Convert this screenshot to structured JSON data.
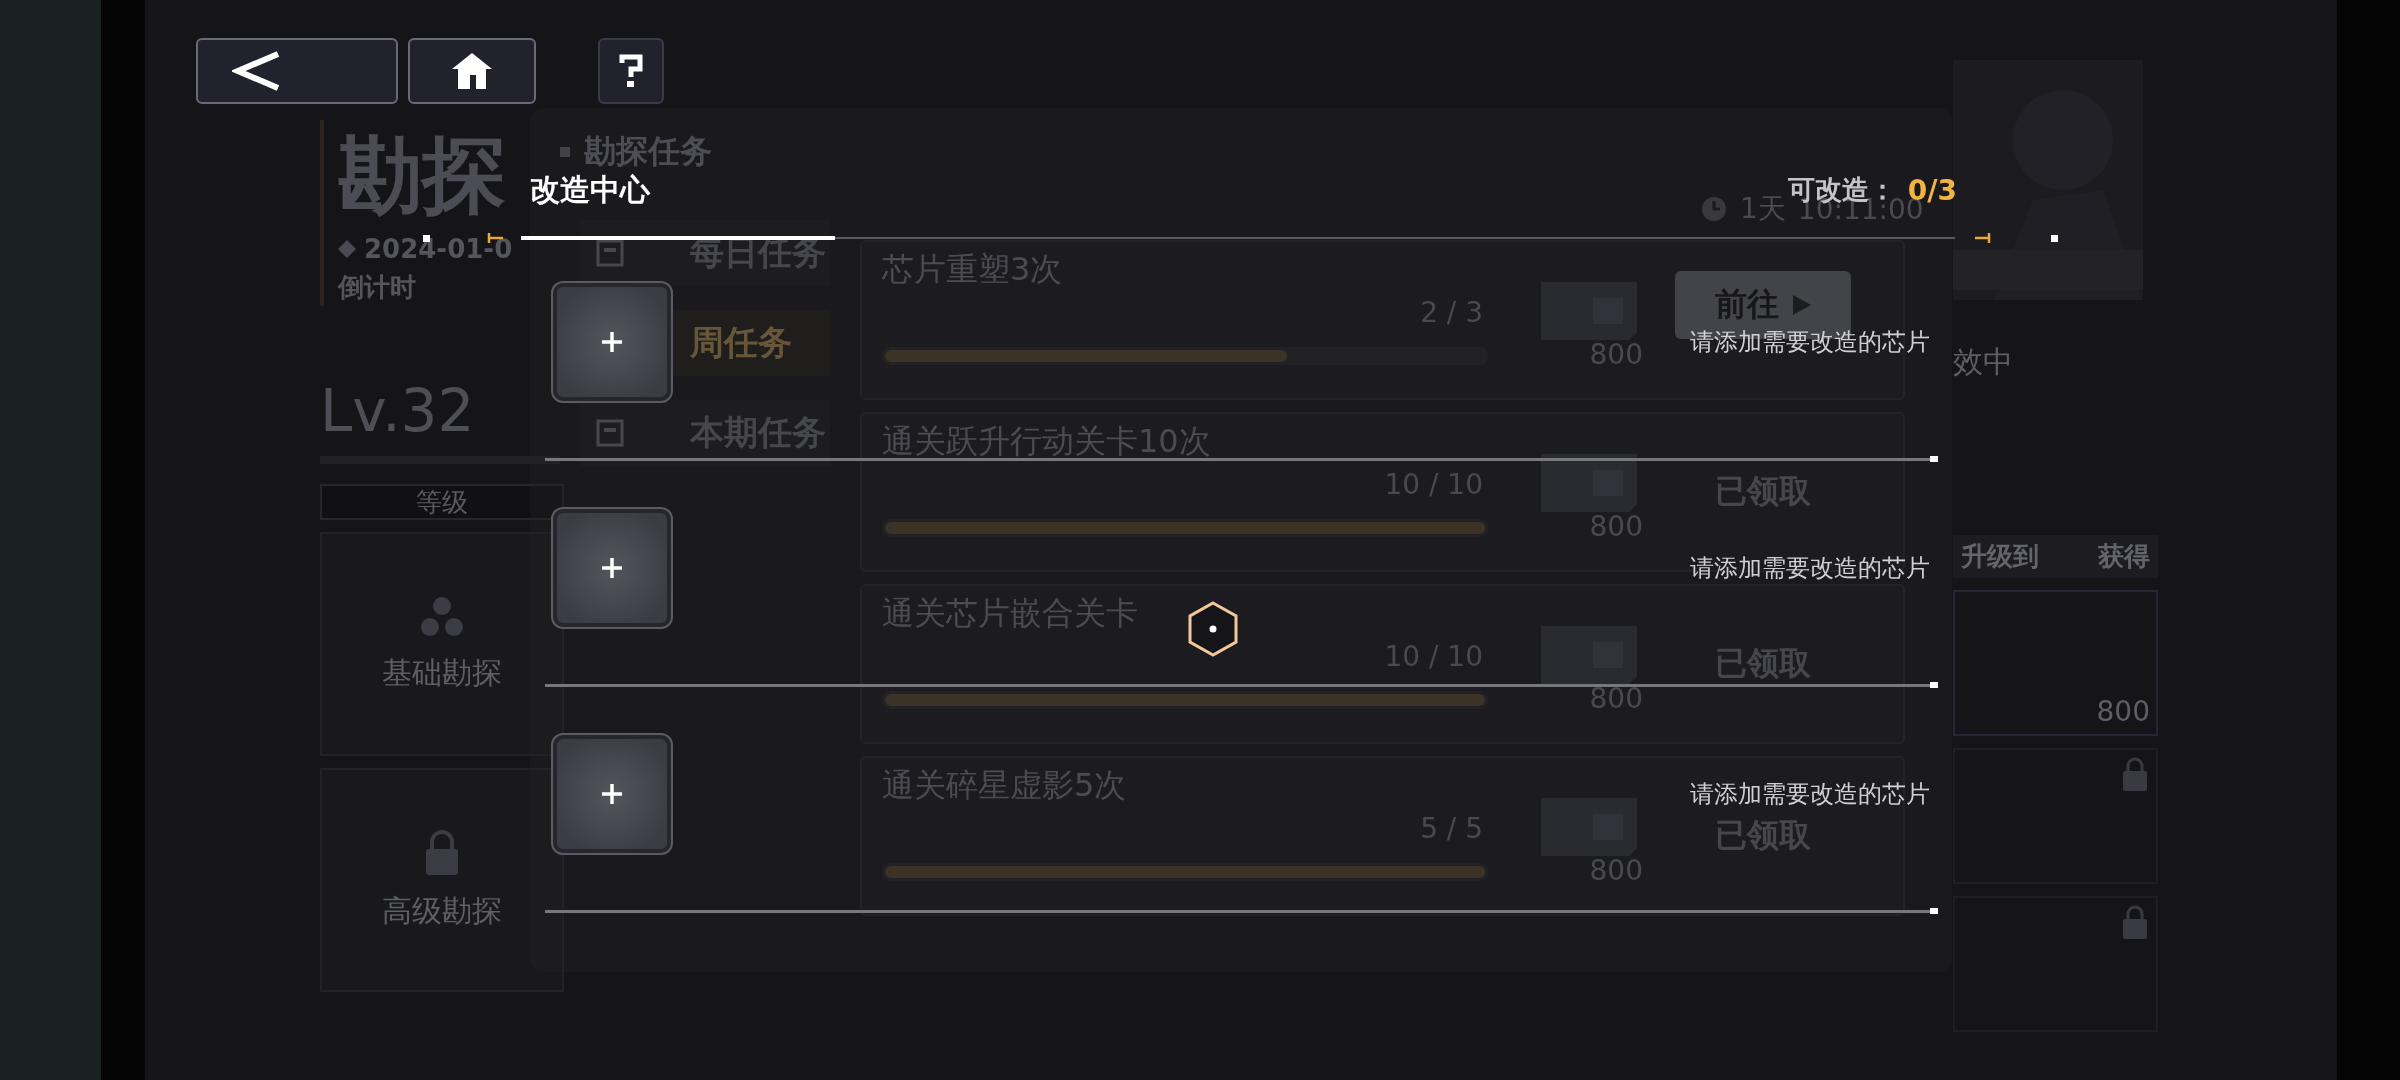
{
  "nav_buttons": [
    {
      "kind": "back"
    },
    {
      "kind": "home"
    },
    {
      "kind": "help"
    }
  ],
  "background": {
    "title": "勘探",
    "section": "勘探任务",
    "date": "2024-01-0",
    "countdown_label": "倒计时",
    "level_text": "Lv.32",
    "level_tab": "等级",
    "modes": [
      {
        "label": "基础勘探",
        "locked": false
      },
      {
        "label": "高级勘探",
        "locked": true
      }
    ],
    "task_tabs": [
      {
        "label": "每日任务",
        "selected": false,
        "icon": true
      },
      {
        "label": "周任务",
        "selected": true,
        "icon": false
      },
      {
        "label": "本期任务",
        "selected": false,
        "icon": true
      }
    ],
    "timer": {
      "days": "1天",
      "time": "10:11:00"
    },
    "tasks": [
      {
        "title": "芯片重塑3次",
        "progress": "2 / 3",
        "level": 0.67,
        "reward": "800",
        "kind": "go",
        "status": "前往"
      },
      {
        "title": "通关跃升行动关卡10次",
        "progress": "10 / 10",
        "level": 1,
        "reward": "800",
        "kind": "claimed",
        "status": "已领取"
      },
      {
        "title": "通关芯片嵌合关卡",
        "progress": "10 / 10",
        "level": 1,
        "reward": "800",
        "kind": "claimed",
        "status": "已领取"
      },
      {
        "title": "通关碎星虚影5次",
        "progress": "5 / 5",
        "level": 1,
        "reward": "800",
        "kind": "claimed",
        "status": "已领取"
      }
    ],
    "side": {
      "status": "效中",
      "upgrade_label": "升级到",
      "gain_label": "获得",
      "reward": "800",
      "locked_items": [
        {
          "locked": true
        },
        {
          "locked": true
        }
      ]
    }
  },
  "overlay": {
    "title": "改造中心",
    "quota_label": "可改造：",
    "quota_value": "0/3",
    "slots": [
      {
        "hint": "请添加需要改造的芯片",
        "filled": false
      },
      {
        "hint": "请添加需要改造的芯片",
        "filled": false
      },
      {
        "hint": "请添加需要改造的芯片",
        "filled": false
      }
    ]
  }
}
